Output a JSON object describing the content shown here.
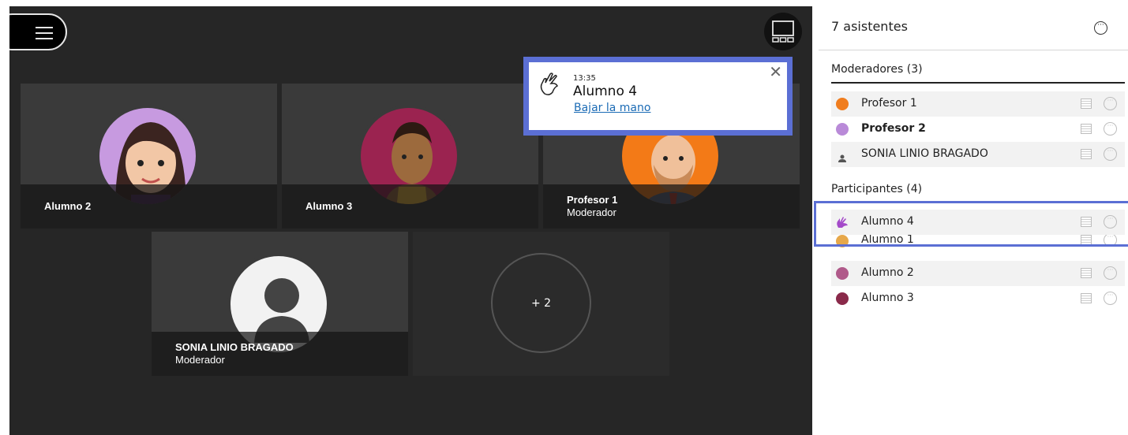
{
  "stage": {
    "menu_icon": "hamburger-icon",
    "layout_icon": "grid-layout-icon",
    "tiles": [
      {
        "name": "Alumno 2",
        "role": ""
      },
      {
        "name": "Alumno 3",
        "role": ""
      },
      {
        "name": "Profesor 1",
        "role": "Moderador"
      },
      {
        "name": "SONIA LINIO BRAGADO",
        "role": "Moderador"
      }
    ],
    "more_label": "+ 2"
  },
  "notification": {
    "time": "13:35",
    "name": "Alumno 4",
    "action": "Bajar la mano",
    "close": "✕",
    "icon": "raised-hand-icon"
  },
  "panel": {
    "title": "7 asistentes",
    "more_icon": "···",
    "moderators_title": "Moderadores (3)",
    "moderators": [
      {
        "name": "Profesor 1",
        "color": "#f07d1e"
      },
      {
        "name": "Profesor 2",
        "color": "#b98ad8"
      },
      {
        "name": "SONIA LINIO BRAGADO",
        "color": "#666666"
      }
    ],
    "participants_title": "Participantes (4)",
    "participants": [
      {
        "name": "Alumno 4",
        "color": "#a44ac9"
      },
      {
        "name": "Alumno 1",
        "color": "#e7a84a"
      },
      {
        "name": "Alumno 2",
        "color": "#b05a8a"
      },
      {
        "name": "Alumno 3",
        "color": "#8a2a4a"
      }
    ]
  },
  "colors": {
    "accent": "#5b6fd4",
    "link": "#1b6bb5",
    "stage_bg": "#262626"
  }
}
